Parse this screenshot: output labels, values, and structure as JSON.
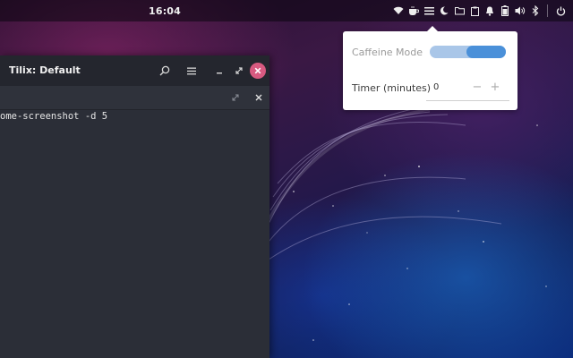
{
  "topbar": {
    "clock": "16:04",
    "tray_icons": [
      "wifi-icon",
      "coffee-icon",
      "menu-icon",
      "night-icon",
      "folder-icon",
      "clipboard-icon",
      "bell-icon",
      "battery-icon",
      "volume-icon",
      "bluetooth-icon",
      "power-icon"
    ]
  },
  "caffeine_popup": {
    "mode_label": "Caffeine Mode",
    "mode_enabled": true,
    "timer_label": "Timer (minutes)",
    "timer_value": "0",
    "minus_label": "−",
    "plus_label": "+",
    "accent_color": "#4a90d9"
  },
  "terminal": {
    "title": "Tilix: Default",
    "close_color": "#d75a80",
    "lines": [
      "ome-screenshot -d 5"
    ]
  }
}
